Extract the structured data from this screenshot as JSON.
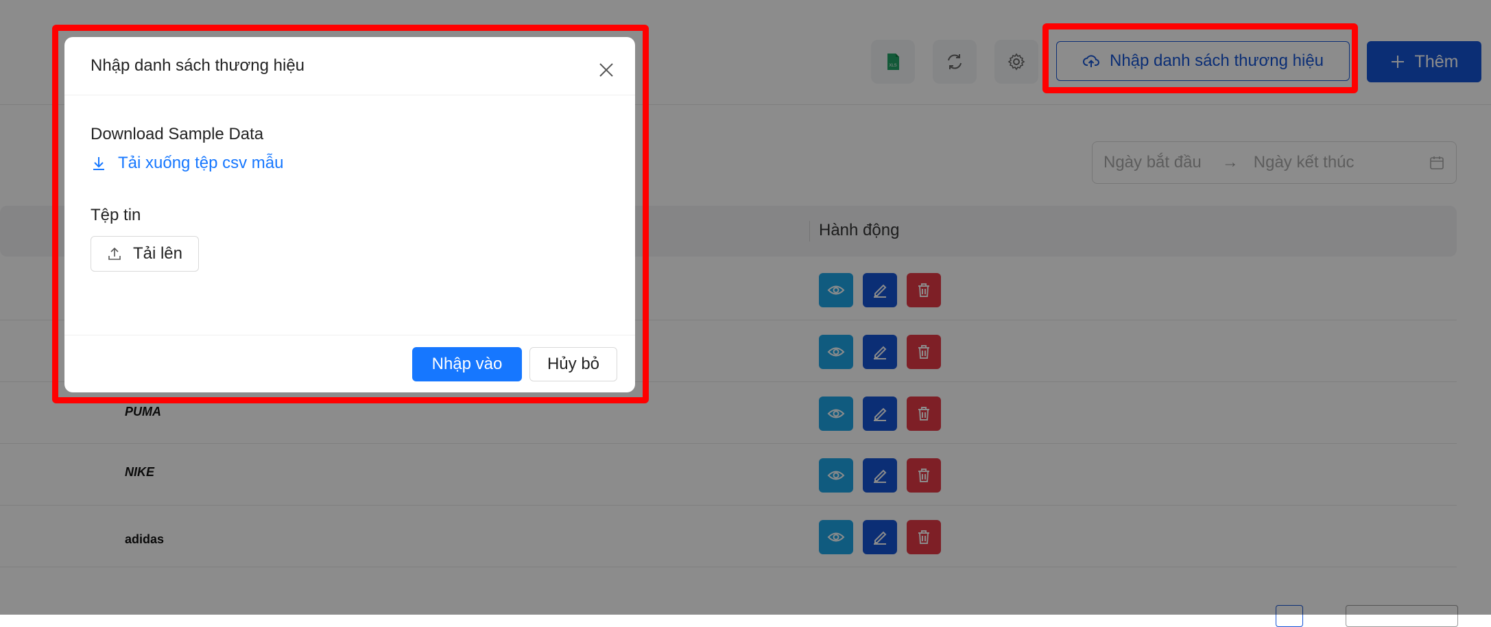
{
  "header": {
    "import_button_label": "Nhập danh sách thương hiệu",
    "add_button_label": "Thêm",
    "excel_badge": "XLS"
  },
  "filters": {
    "start_date_placeholder": "Ngày bắt đầu",
    "end_date_placeholder": "Ngày kết thúc",
    "range_separator": "→"
  },
  "table": {
    "columns": [
      "Hành động"
    ],
    "rows": [
      {
        "logo": ""
      },
      {
        "logo": ""
      },
      {
        "logo": "PUMA"
      },
      {
        "logo": "NIKE"
      },
      {
        "logo": "adidas"
      }
    ]
  },
  "modal": {
    "title": "Nhập danh sách thương hiệu",
    "download_label": "Download Sample Data",
    "download_link": "Tải xuống tệp csv mẫu",
    "file_label": "Tệp tin",
    "upload_button": "Tải lên",
    "ok_button": "Nhập vào",
    "cancel_button": "Hủy bỏ"
  },
  "colors": {
    "primary": "#1554d6",
    "modal_primary": "#1677ff",
    "view": "#1ea7e8",
    "delete": "#e63946",
    "highlight": "#ff0000"
  }
}
